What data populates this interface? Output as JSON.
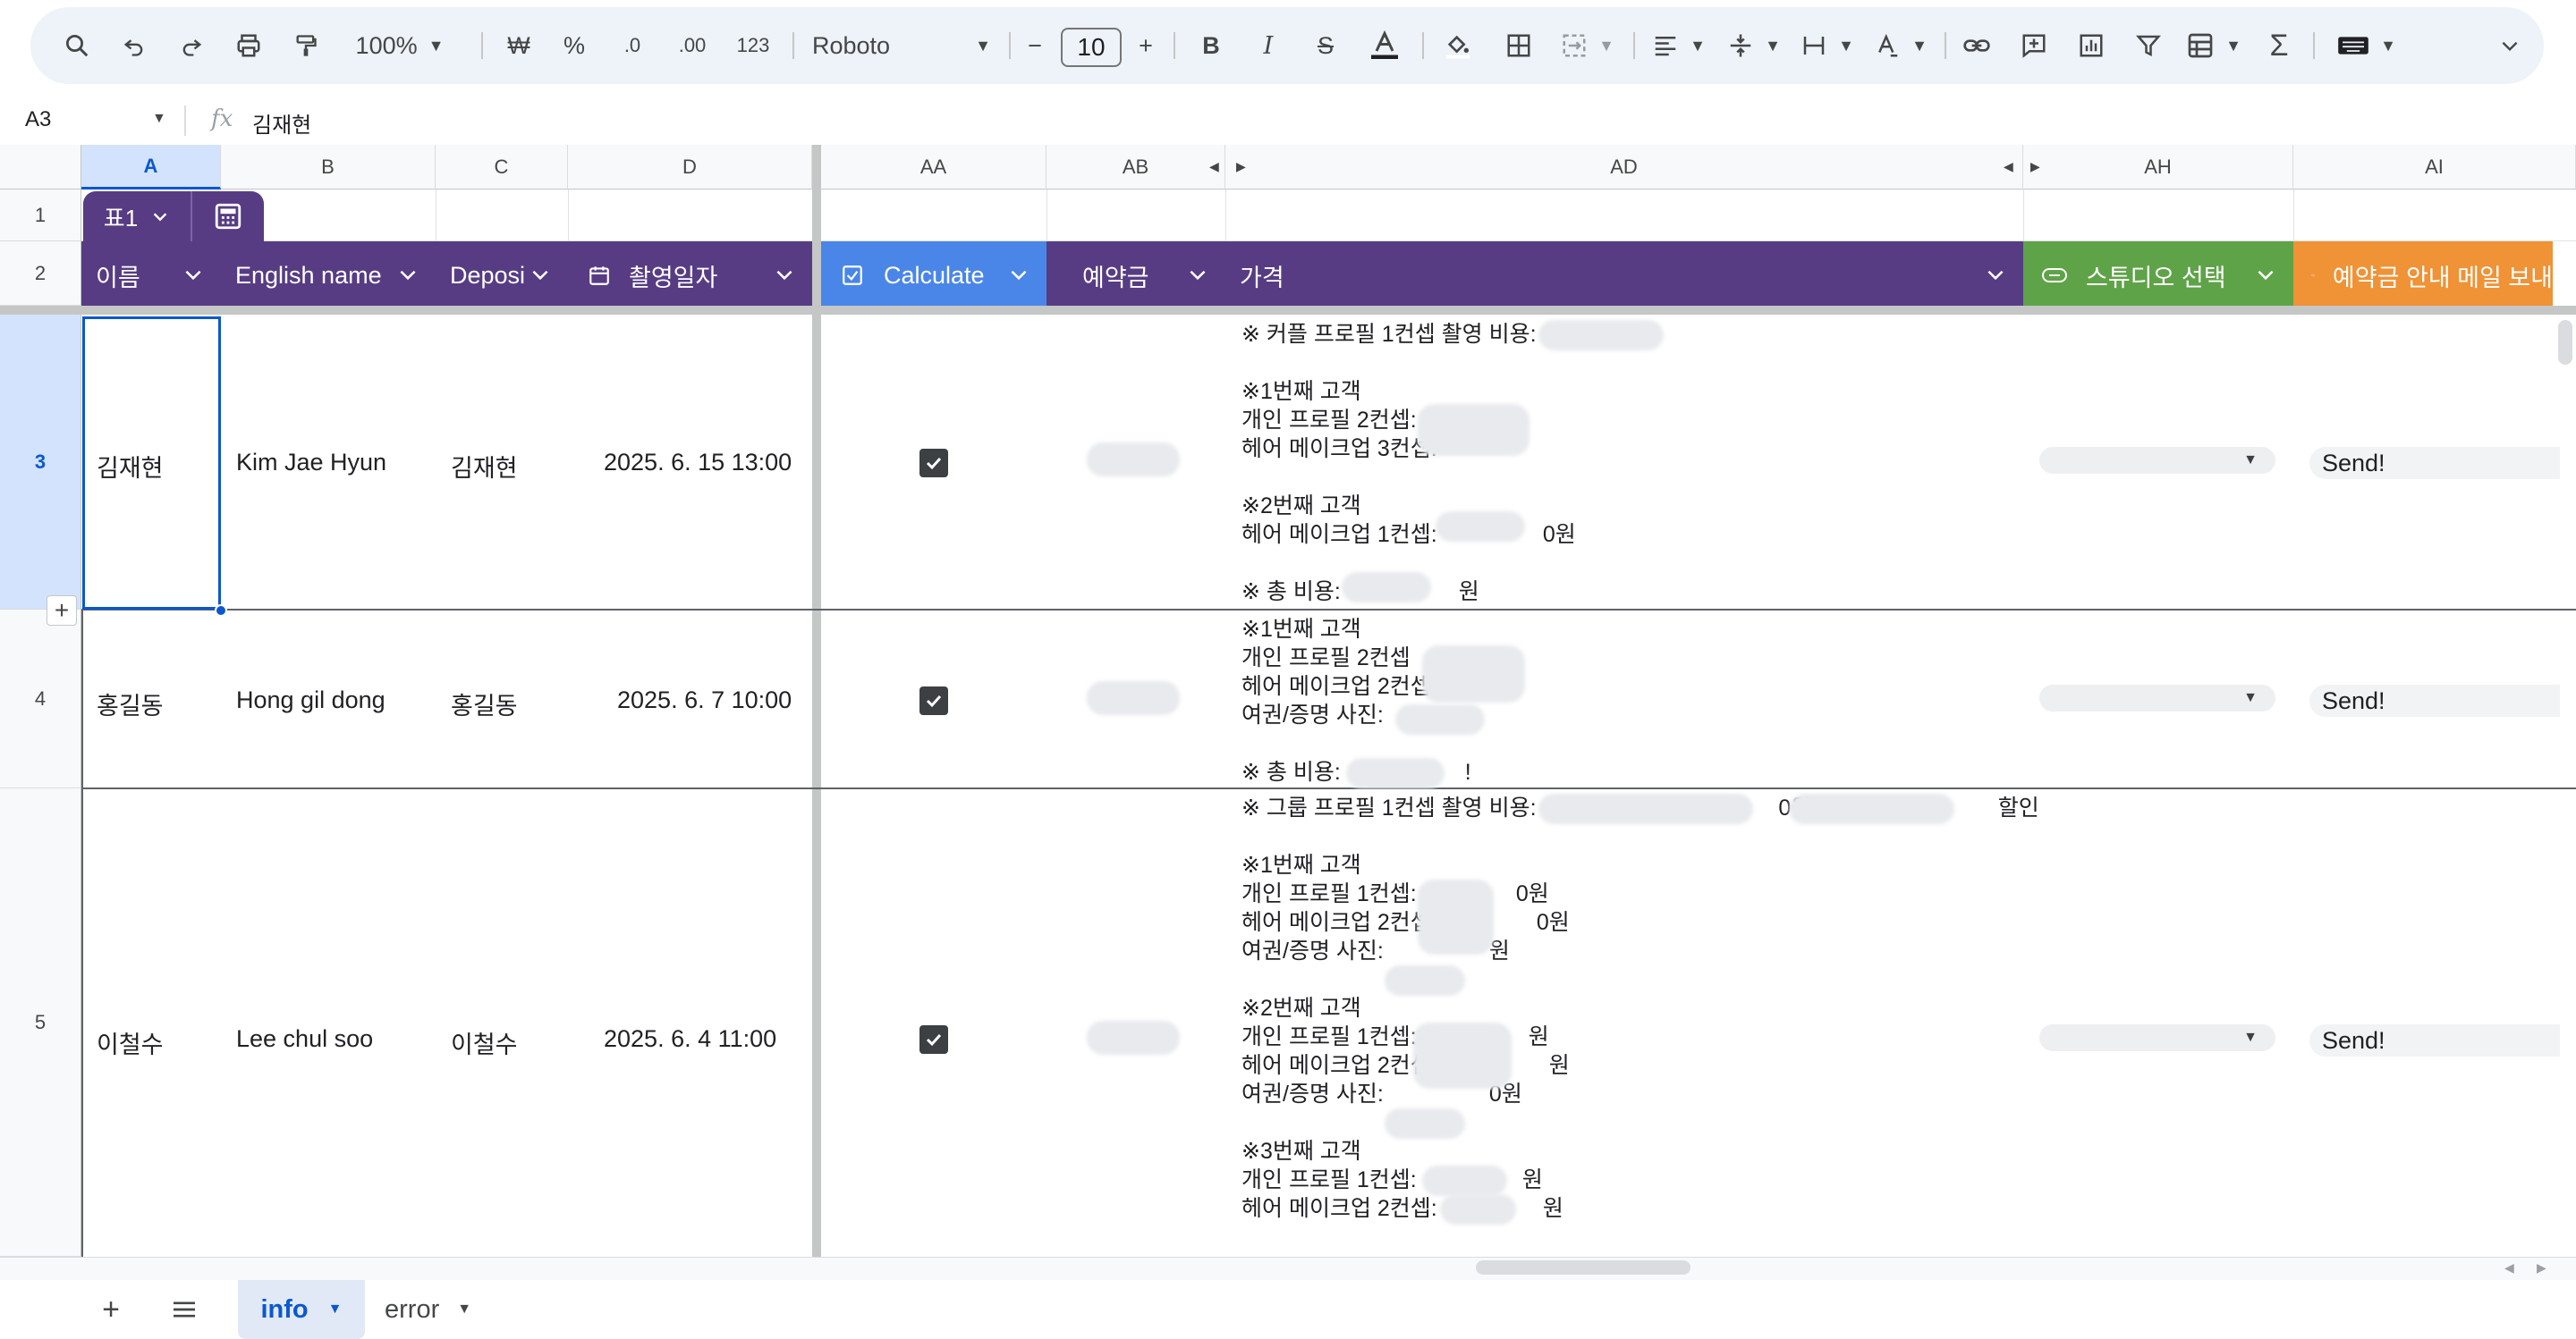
{
  "toolbar": {
    "zoom": "100%",
    "currency": "₩",
    "percent": "%",
    "decimal_decrease": ".0",
    "decimal_increase": ".00",
    "number_format": "123",
    "font": "Roboto",
    "font_size": "10",
    "minus": "−",
    "plus": "+"
  },
  "formula_bar": {
    "cell_ref": "A3",
    "fx": "fx",
    "content": "김재현"
  },
  "columns": {
    "a": "A",
    "b": "B",
    "c": "C",
    "d": "D",
    "aa": "AA",
    "ab": "AB",
    "ad": "AD",
    "ah": "AH",
    "ai": "AI"
  },
  "rows": {
    "r1": "1",
    "r2": "2",
    "r3": "3",
    "r4": "4",
    "r5": "5"
  },
  "table_chip": {
    "name": "표1"
  },
  "headers": {
    "name": "이름",
    "english_name": "English name",
    "deposit": "Deposi",
    "date": "촬영일자",
    "calculate": "Calculate",
    "reservation_fee": "예약금",
    "price": "가격",
    "studio": "스튜디오 선택",
    "mail": "예약금 안내 메일 보내"
  },
  "data_rows": [
    {
      "name": "김재현",
      "english_name": "Kim Jae Hyun",
      "deposit": "김재현",
      "date": "2025. 6. 15  13:00",
      "send": "Send!",
      "price": "※ 커플 프로필 1컨셉 촬영 비용:\n\n※1번째 고객\n개인 프로필 2컨셉:\n헤어 메이크업 3컨셉:\n\n※2번째 고객\n헤어 메이크업 1컨셉:                 0원\n\n※ 총 비용:                   원"
    },
    {
      "name": "홍길동",
      "english_name": "Hong gil dong",
      "deposit": "홍길동",
      "date": "2025. 6. 7  10:00",
      "send": "Send!",
      "price": "※1번째 고객\n개인 프로필 2컨셉\n헤어 메이크업 2컨셉:\n여권/증명 사진:\n\n※ 총 비용:                    !"
    },
    {
      "name": "이철수",
      "english_name": "Lee chul soo",
      "deposit": "이철수",
      "date": "2025. 6. 4  11:00",
      "send": "Send!",
      "price": "※ 그룹 프로필 1컨셉 촬영 비용:                                       0원                              할인\n\n※1번째 고객\n개인 프로필 1컨셉:                0원\n헤어 메이크업 2컨셉                 0원\n여권/증명 사진:                 원\n\n※2번째 고객\n개인 프로필 1컨셉:                  원\n헤어 메이크업 2컨셉                   원\n여권/증명 사진:                 0원\n\n※3번째 고객\n개인 프로필 1컨셉:                 원\n헤어 메이크업 2컨셉:                 원"
    }
  ],
  "sheets": {
    "add": "+",
    "active": "info",
    "other": "error"
  },
  "colors": {
    "purple": "#573c84",
    "blue": "#4a86e8",
    "green": "#5fa348",
    "orange": "#f09236",
    "selection": "#0b57d0"
  }
}
